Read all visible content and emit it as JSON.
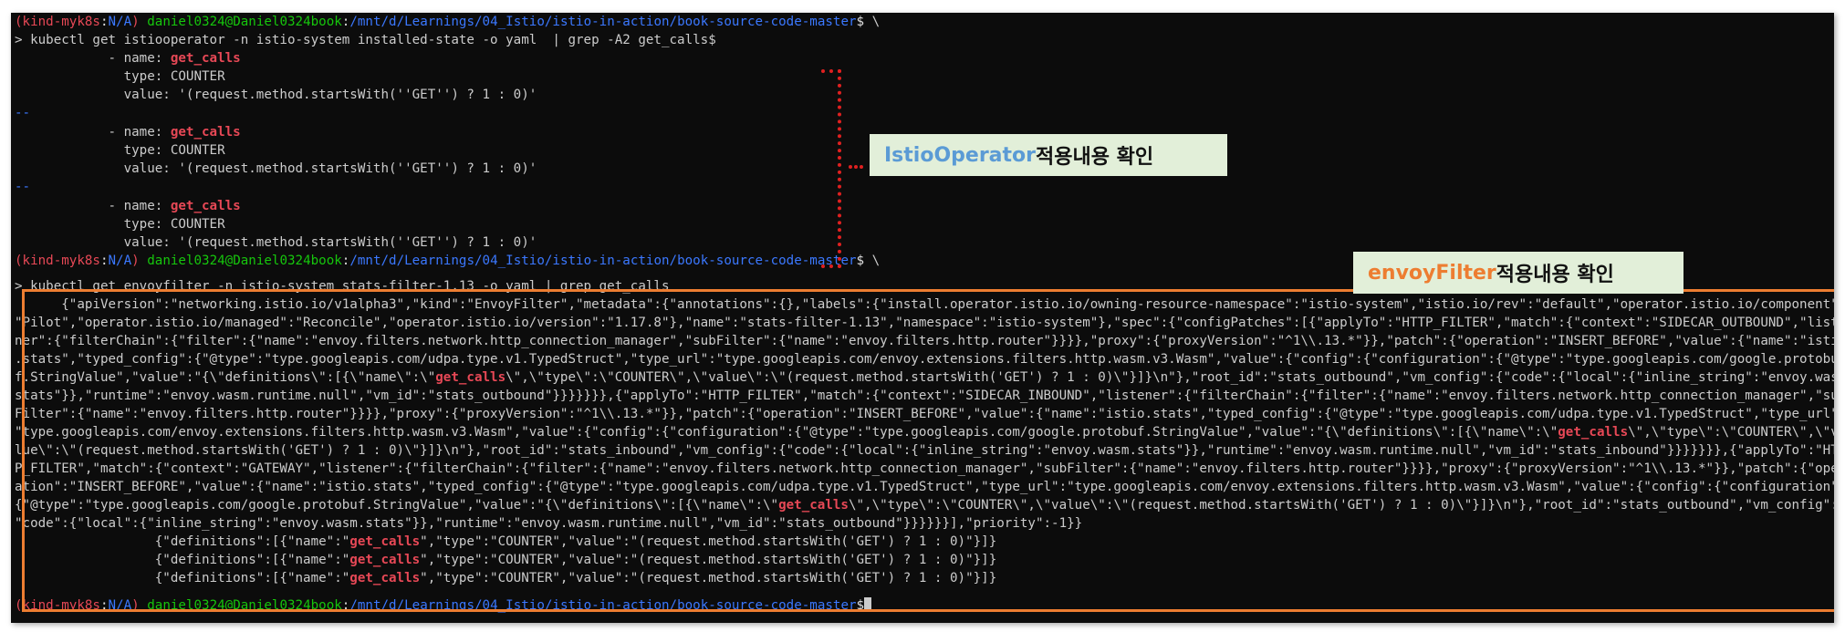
{
  "prompt": {
    "ctx_open": "(",
    "ctx": "kind-myk8s",
    "ctx_sep": ":",
    "ns": "N/A",
    "ctx_close": ")",
    "user": "daniel0324@Daniel0324book",
    "colon": ":",
    "path": "/mnt/d/Learnings/04_Istio/istio-in-action/book-source-code-master",
    "dollar": "$",
    "continuation": " \\"
  },
  "cmd1": "> kubectl get istiooperator -n istio-system installed-state -o yaml  | grep -A2 get_calls$",
  "metric": {
    "name_prefix": "            - name: ",
    "name": "get_calls",
    "type": "              type: COUNTER",
    "value": "              value: '(request.method.startsWith(''GET'') ? 1 : 0)'",
    "separator": "--"
  },
  "cmd2": "> kubectl get envoyfilter -n istio-system stats-filter-1.13 -o yaml | grep get_calls",
  "json_lines": [
    "      {\"apiVersion\":\"networking.istio.io/v1alpha3\",\"kind\":\"EnvoyFilter\",\"metadata\":{\"annotations\":{},\"labels\":{\"install.operator.istio.io/owning-resource-namespace\":\"istio-system\",\"istio.io/rev\":\"default\",\"operator.istio.io/component\":",
    "\"Pilot\",\"operator.istio.io/managed\":\"Reconcile\",\"operator.istio.io/version\":\"1.17.8\"},\"name\":\"stats-filter-1.13\",\"namespace\":\"istio-system\"},\"spec\":{\"configPatches\":[{\"applyTo\":\"HTTP_FILTER\",\"match\":{\"context\":\"SIDECAR_OUTBOUND\",\"liste",
    "ner\":{\"filterChain\":{\"filter\":{\"name\":\"envoy.filters.network.http_connection_manager\",\"subFilter\":{\"name\":\"envoy.filters.http.router\"}}}},\"proxy\":{\"proxyVersion\":\"^1\\\\.13.*\"}},\"patch\":{\"operation\":\"INSERT_BEFORE\",\"value\":{\"name\":\"istio",
    ".stats\",\"typed_config\":{\"@type\":\"type.googleapis.com/udpa.type.v1.TypedStruct\",\"type_url\":\"type.googleapis.com/envoy.extensions.filters.http.wasm.v3.Wasm\",\"value\":{\"config\":{\"configuration\":{\"@type\":\"type.googleapis.com/google.protobu",
    "f.StringValue\",\"value\":\"{\\\"definitions\\\":[{\\\"name\\\":\\\"",
    "\\\",\\\"type\\\":\\\"COUNTER\\\",\\\"value\\\":\\\"(request.method.startsWith('GET') ? 1 : 0)\\\"}]}\\n\"},\"root_id\":\"stats_outbound\",\"vm_config\":{\"code\":{\"local\":{\"inline_string\":\"envoy.wasm.",
    "stats\"}},\"runtime\":\"envoy.wasm.runtime.null\",\"vm_id\":\"stats_outbound\"}}}}}}},{\"applyTo\":\"HTTP_FILTER\",\"match\":{\"context\":\"SIDECAR_INBOUND\",\"listener\":{\"filterChain\":{\"filter\":{\"name\":\"envoy.filters.network.http_connection_manager\",\"sub",
    "Filter\":{\"name\":\"envoy.filters.http.router\"}}}},\"proxy\":{\"proxyVersion\":\"^1\\\\.13.*\"}},\"patch\":{\"operation\":\"INSERT_BEFORE\",\"value\":{\"name\":\"istio.stats\",\"typed_config\":{\"@type\":\"type.googleapis.com/udpa.type.v1.TypedStruct\",\"type_url\":",
    "\"type.googleapis.com/envoy.extensions.filters.http.wasm.v3.Wasm\",\"value\":{\"config\":{\"configuration\":{\"@type\":\"type.googleapis.com/google.protobuf.StringValue\",\"value\":\"{\\\"definitions\\\":[{\\\"name\\\":\\\"",
    "\\\",\\\"type\\\":\\\"COUNTER\\\",\\\"va",
    "lue\\\":\\\"(request.method.startsWith('GET') ? 1 : 0)\\\"}]}\\n\"},\"root_id\":\"stats_inbound\",\"vm_config\":{\"code\":{\"local\":{\"inline_string\":\"envoy.wasm.stats\"}},\"runtime\":\"envoy.wasm.runtime.null\",\"vm_id\":\"stats_inbound\"}}}}}}},{\"applyTo\":\"HTT",
    "P_FILTER\",\"match\":{\"context\":\"GATEWAY\",\"listener\":{\"filterChain\":{\"filter\":{\"name\":\"envoy.filters.network.http_connection_manager\",\"subFilter\":{\"name\":\"envoy.filters.http.router\"}}}},\"proxy\":{\"proxyVersion\":\"^1\\\\.13.*\"}},\"patch\":{\"oper",
    "ation\":\"INSERT_BEFORE\",\"value\":{\"name\":\"istio.stats\",\"typed_config\":{\"@type\":\"type.googleapis.com/udpa.type.v1.TypedStruct\",\"type_url\":\"type.googleapis.com/envoy.extensions.filters.http.wasm.v3.Wasm\",\"value\":{\"config\":{\"configuration\":",
    "{\"@type\":\"type.googleapis.com/google.protobuf.StringValue\",\"value\":\"{\\\"definitions\\\":[{\\\"name\\\":\\\"",
    "\\\",\\\"type\\\":\\\"COUNTER\\\",\\\"value\\\":\\\"(request.method.startsWith('GET') ? 1 : 0)\\\"}]}\\n\"},\"root_id\":\"stats_outbound\",\"vm_config\":",
    "\"code\":{\"local\":{\"inline_string\":\"envoy.wasm.stats\"}},\"runtime\":\"envoy.wasm.runtime.null\",\"vm_id\":\"stats_outbound\"}}}}}}],\"priority\":-1}}"
  ],
  "defs": {
    "prefix": "                  {\"definitions\":[{\"name\":\"",
    "suffix": "\",\"type\":\"COUNTER\",\"value\":\"(request.method.startsWith('GET') ? 1 : 0)\"}]}"
  },
  "annotations": {
    "istio_keyword": "IstioOperator",
    "istio_text": " 적용내용 확인",
    "envoy_keyword": "envoyFilter",
    "envoy_text": " 적용내용 확인"
  },
  "colors": {
    "background": "#0c0c0c",
    "text": "#cccccc",
    "highlight": "#e74856",
    "prompt_user": "#16c60c",
    "prompt_path": "#3b78ff",
    "annotation_bg": "#e2efd9",
    "annotation_blue": "#5b9bd5",
    "annotation_orange": "#ed7d31",
    "bracket": "#e02020"
  }
}
